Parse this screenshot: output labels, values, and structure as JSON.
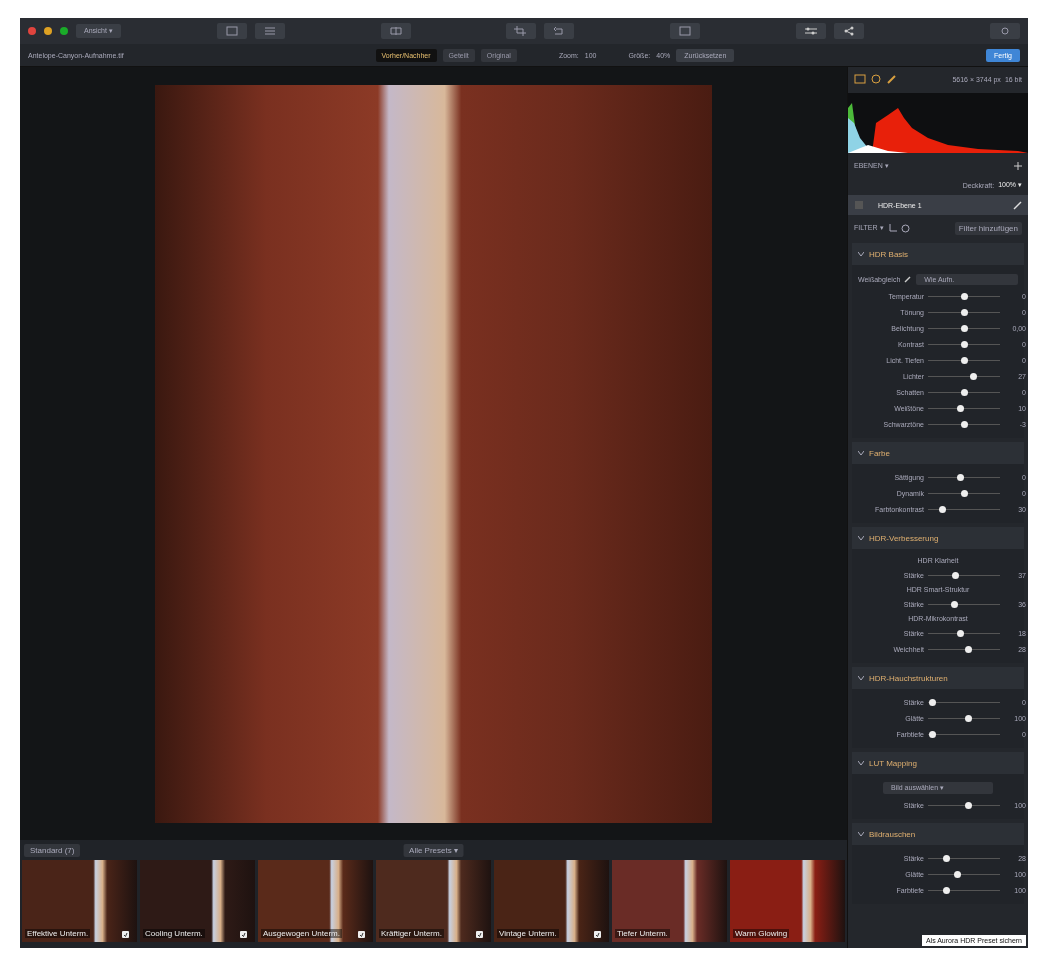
{
  "title_bar": {
    "menu_button": "Ansicht ▾"
  },
  "toolbar": {
    "file_name": "Antelope-Canyon-Aufnahme.tif",
    "view_modes": [
      {
        "label": "Vorher/Nachher",
        "selected": true
      },
      {
        "label": "Geteilt",
        "selected": false
      },
      {
        "label": "Original",
        "selected": false
      }
    ],
    "zoom_label": "Zoom:",
    "zoom_value": "100",
    "size_label": "Größe:",
    "size_value": "40%",
    "reset_button": "Zurücksetzen",
    "done_button": "Fertig"
  },
  "panel": {
    "image_size": "5616 × 3744 px",
    "bit_depth": "16 bit",
    "layers_heading": "EBENEN ▾",
    "opacity_label": "Deckkraft:",
    "opacity_value": "100% ▾",
    "layer_name": "HDR-Ebene 1",
    "filters_heading": "FILTER ▾",
    "filter_button": "Filter hinzufügen",
    "sections": [
      {
        "title": "HDR Basis",
        "rows": [
          {
            "kind": "dropdown",
            "label": "Weißabgleich",
            "value": "Wie Aufn."
          },
          {
            "kind": "slider",
            "label": "Temperatur",
            "level": 0.5,
            "reading": "0"
          },
          {
            "kind": "slider",
            "label": "Tönung",
            "level": 0.5,
            "reading": "0"
          },
          {
            "kind": "slider",
            "label": "Belichtung",
            "level": 0.5,
            "reading": "0,00"
          },
          {
            "kind": "slider",
            "label": "Kontrast",
            "level": 0.5,
            "reading": "0"
          },
          {
            "kind": "slider",
            "label": "Licht. Tiefen",
            "level": 0.5,
            "reading": "0"
          },
          {
            "kind": "slider",
            "label": "Lichter",
            "level": 0.63,
            "reading": "27"
          },
          {
            "kind": "slider",
            "label": "Schatten",
            "level": 0.5,
            "reading": "0"
          },
          {
            "kind": "slider",
            "label": "Weißtöne",
            "level": 0.45,
            "reading": "10"
          },
          {
            "kind": "slider",
            "label": "Schwarztöne",
            "level": 0.5,
            "reading": "-3"
          }
        ]
      },
      {
        "title": "Farbe",
        "rows": [
          {
            "kind": "slider",
            "label": "Sättigung",
            "level": 0.45,
            "reading": "0"
          },
          {
            "kind": "slider",
            "label": "Dynamik",
            "level": 0.5,
            "reading": "0"
          },
          {
            "kind": "slider",
            "label": "Farbtonkontrast",
            "level": 0.2,
            "reading": "30"
          }
        ]
      },
      {
        "title": "HDR-Verbesserung",
        "rows": [
          {
            "kind": "subheading",
            "label": "HDR Klarheit"
          },
          {
            "kind": "slider",
            "label": "Stärke",
            "level": 0.37,
            "reading": "37"
          },
          {
            "kind": "subheading",
            "label": "HDR Smart-Struktur"
          },
          {
            "kind": "slider",
            "label": "Stärke",
            "level": 0.36,
            "reading": "36"
          },
          {
            "kind": "subheading",
            "label": "HDR-Mikrokontrast"
          },
          {
            "kind": "slider",
            "label": "Stärke",
            "level": 0.45,
            "reading": "18"
          },
          {
            "kind": "slider",
            "label": "Weichheit",
            "level": 0.55,
            "reading": "28"
          }
        ]
      },
      {
        "title": "HDR-Hauchstrukturen",
        "rows": [
          {
            "kind": "slider",
            "label": "Stärke",
            "level": 0.05,
            "reading": "0"
          },
          {
            "kind": "slider",
            "label": "Glätte",
            "level": 0.55,
            "reading": "100"
          },
          {
            "kind": "slider",
            "label": "Farbtiefe",
            "level": 0.05,
            "reading": "0"
          }
        ]
      },
      {
        "title": "LUT Mapping",
        "rows": [
          {
            "kind": "dropdown",
            "label": "",
            "value": "Bild auswählen ▾"
          },
          {
            "kind": "slider",
            "label": "Stärke",
            "level": 0.55,
            "reading": "100"
          }
        ]
      },
      {
        "title": "Bildrauschen",
        "rows": [
          {
            "kind": "slider",
            "label": "Stärke",
            "level": 0.25,
            "reading": "28"
          },
          {
            "kind": "slider",
            "label": "Glätte",
            "level": 0.4,
            "reading": "100"
          },
          {
            "kind": "slider",
            "label": "Farbtiefe",
            "level": 0.25,
            "reading": "100"
          }
        ]
      }
    ],
    "tooltip": "Als Aurora HDR Preset sichern"
  },
  "filmstrip": {
    "category_button": "Standard (7)",
    "presets_dropdown": "Alle Presets ▾",
    "presets": [
      {
        "name": "Effektive Unterm.",
        "badge": true
      },
      {
        "name": "Cooling Unterm.",
        "badge": true
      },
      {
        "name": "Ausgewogen Unterm.",
        "badge": true
      },
      {
        "name": "Kräftiger Unterm.",
        "badge": true
      },
      {
        "name": "Vintage Unterm.",
        "badge": true
      },
      {
        "name": "Tiefer Unterm.",
        "badge": false
      },
      {
        "name": "Warm Glowing",
        "badge": false
      }
    ]
  }
}
